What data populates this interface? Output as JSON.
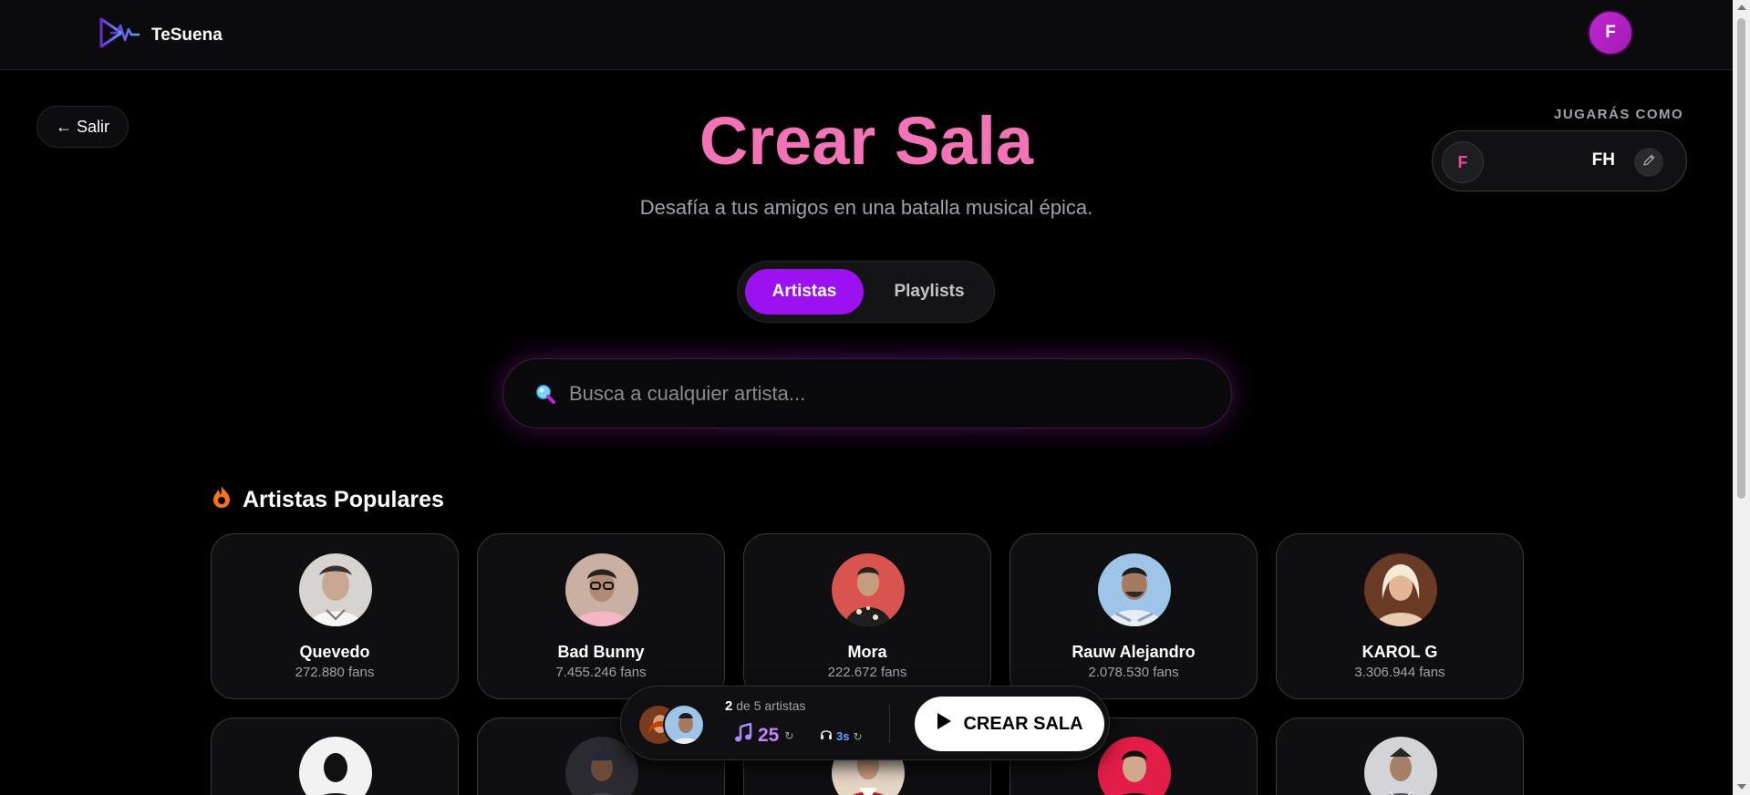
{
  "header": {
    "brand": "TeSuena",
    "avatar_initial": "F"
  },
  "exit_label": "← Salir",
  "player": {
    "label": "JUGARÁS COMO",
    "avatar_initial": "F",
    "name": "FH"
  },
  "hero": {
    "title": "Crear Sala",
    "subtitle": "Desafía a tus amigos en una batalla musical épica."
  },
  "tabs": [
    {
      "label": "Artistas",
      "active": true
    },
    {
      "label": "Playlists",
      "active": false
    }
  ],
  "search": {
    "placeholder": "Busca a cualquier artista..."
  },
  "section": {
    "title": "Artistas Populares"
  },
  "artists": [
    {
      "name": "Quevedo",
      "fans": "272.880 fans"
    },
    {
      "name": "Bad Bunny",
      "fans": "7.455.246 fans"
    },
    {
      "name": "Mora",
      "fans": "222.672 fans"
    },
    {
      "name": "Rauw Alejandro",
      "fans": "2.078.530 fans"
    },
    {
      "name": "KAROL G",
      "fans": "3.306.944 fans"
    }
  ],
  "create_bar": {
    "selected": "2",
    "of_total": "de 5 artistas",
    "songs": "25",
    "seconds": "3s",
    "button_label": "CREAR SALA"
  },
  "colors": {
    "accent_pink": "#f472b6",
    "accent_purple": "#9b11f0",
    "background": "#000000"
  }
}
